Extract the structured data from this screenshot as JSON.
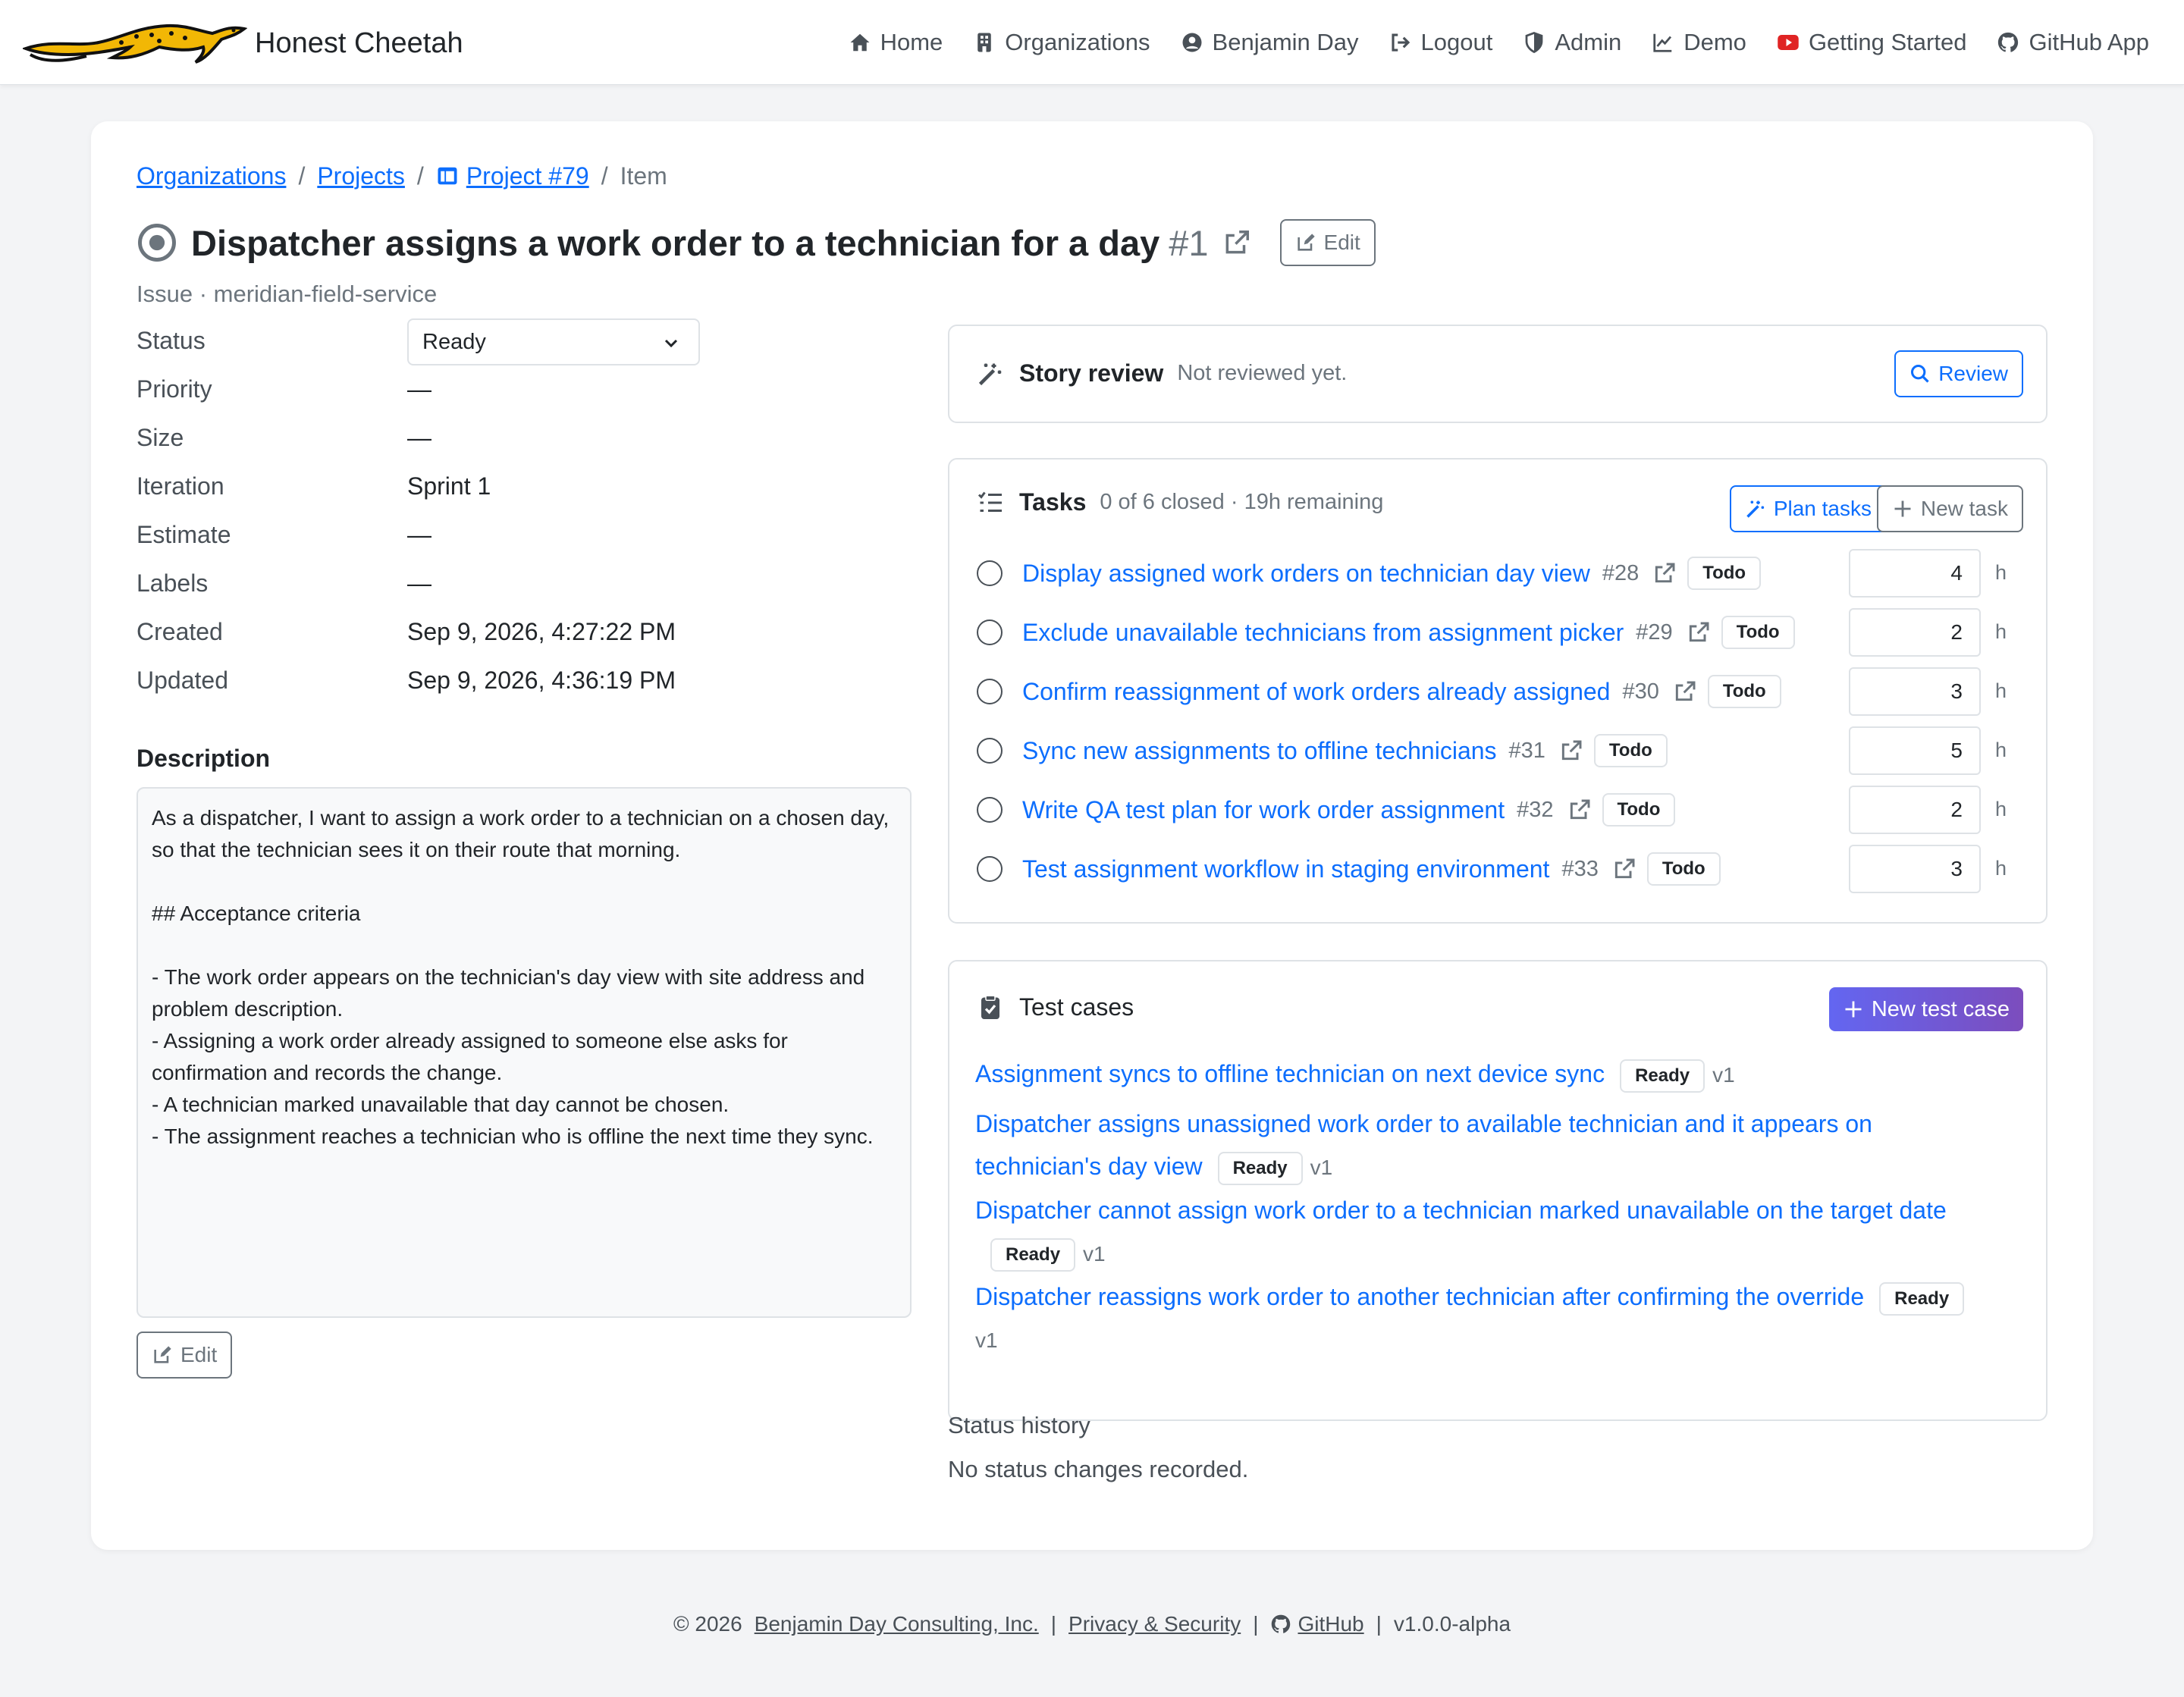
{
  "brand": {
    "name": "Honest Cheetah"
  },
  "nav": [
    {
      "label": "Home",
      "icon": "home-icon"
    },
    {
      "label": "Organizations",
      "icon": "building-icon"
    },
    {
      "label": "Benjamin Day",
      "icon": "user-circle-icon"
    },
    {
      "label": "Logout",
      "icon": "logout-icon"
    },
    {
      "label": "Admin",
      "icon": "shield-icon"
    },
    {
      "label": "Demo",
      "icon": "chart-line-icon"
    },
    {
      "label": "Getting Started",
      "icon": "youtube-icon"
    },
    {
      "label": "GitHub App",
      "icon": "github-icon"
    }
  ],
  "breadcrumb": {
    "organizations": "Organizations",
    "projects": "Projects",
    "project": "Project #79",
    "current": "Item",
    "separator": "/"
  },
  "item": {
    "title": "Dispatcher assigns a work order to a technician for a day",
    "number": "#1",
    "edit_label": "Edit",
    "subtitle": "Issue · meridian-field-service"
  },
  "fields": {
    "status": {
      "label": "Status",
      "value": "Ready"
    },
    "priority": {
      "label": "Priority",
      "value": "—"
    },
    "size": {
      "label": "Size",
      "value": "—"
    },
    "iteration": {
      "label": "Iteration",
      "value": "Sprint 1"
    },
    "estimate": {
      "label": "Estimate",
      "value": "—"
    },
    "labels": {
      "label": "Labels",
      "value": "—"
    },
    "created": {
      "label": "Created",
      "value": "Sep 9, 2026, 4:27:22 PM"
    },
    "updated": {
      "label": "Updated",
      "value": "Sep 9, 2026, 4:36:19 PM"
    }
  },
  "description": {
    "heading": "Description",
    "lines": [
      "As a dispatcher, I want to assign a work order to a technician on a chosen day, so that the technician sees it on their route that morning.",
      "## Acceptance criteria",
      "- The work order appears on the technician's day view with site address and problem description.",
      "- Assigning a work order already assigned to someone else asks for confirmation and records the change.",
      "- A technician marked unavailable that day cannot be chosen.",
      "- The assignment reaches a technician who is offline the next time they sync."
    ],
    "edit_label": "Edit"
  },
  "story_review": {
    "title": "Story review",
    "status": "Not reviewed yet.",
    "button": "Review"
  },
  "tasks": {
    "title": "Tasks",
    "summary": "0 of 6 closed · 19h remaining",
    "plan_button": "Plan tasks",
    "new_button": "New task",
    "unit": "h",
    "items": [
      {
        "title": "Display assigned work orders on technician day view",
        "number": "#28",
        "status": "Todo",
        "estimate": "4"
      },
      {
        "title": "Exclude unavailable technicians from assignment picker",
        "number": "#29",
        "status": "Todo",
        "estimate": "2"
      },
      {
        "title": "Confirm reassignment of work orders already assigned",
        "number": "#30",
        "status": "Todo",
        "estimate": "3"
      },
      {
        "title": "Sync new assignments to offline technicians",
        "number": "#31",
        "status": "Todo",
        "estimate": "5"
      },
      {
        "title": "Write QA test plan for work order assignment",
        "number": "#32",
        "status": "Todo",
        "estimate": "2"
      },
      {
        "title": "Test assignment workflow in staging environment",
        "number": "#33",
        "status": "Todo",
        "estimate": "3"
      }
    ]
  },
  "test_cases": {
    "title": "Test cases",
    "new_button": "New test case",
    "items": [
      {
        "title": "Assignment syncs to offline technician on next device sync",
        "status": "Ready",
        "version": "v1"
      },
      {
        "title": "Dispatcher assigns unassigned work order to available technician and it appears on technician's day view",
        "status": "Ready",
        "version": "v1"
      },
      {
        "title": "Dispatcher cannot assign work order to a technician marked unavailable on the target date",
        "status": "Ready",
        "version": "v1"
      },
      {
        "title": "Dispatcher reassigns work order to another technician after confirming the override",
        "status": "Ready",
        "version": "v1"
      }
    ]
  },
  "status_history": {
    "title": "Status history",
    "text": "No status changes recorded."
  },
  "footer": {
    "copyright": "© 2026",
    "company": "Benjamin Day Consulting, Inc.",
    "privacy": "Privacy & Security",
    "github": "GitHub",
    "version": "v1.0.0-alpha",
    "separator": "|"
  },
  "colors": {
    "link": "#0d6efd",
    "accent_gradient_start": "#6366f1",
    "accent_gradient_end": "#7c4dbd",
    "logo_yellow": "#f2b705",
    "youtube_red": "#e02424"
  }
}
